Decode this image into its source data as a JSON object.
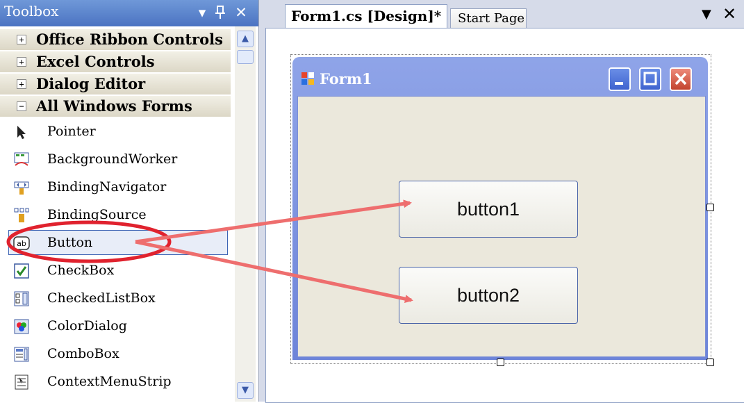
{
  "toolbox": {
    "title": "Toolbox",
    "dropdown_glyph": "▾",
    "pin_glyph": "ᵖ",
    "close_glyph": "✕",
    "categories": [
      {
        "label": "Office Ribbon Controls",
        "expand": "+"
      },
      {
        "label": "Excel Controls",
        "expand": "+"
      },
      {
        "label": "Dialog Editor",
        "expand": "+"
      },
      {
        "label": "All Windows Forms",
        "expand": "−"
      }
    ],
    "items": [
      {
        "label": "Pointer",
        "icon": "pointer-icon"
      },
      {
        "label": "BackgroundWorker",
        "icon": "background-worker-icon"
      },
      {
        "label": "BindingNavigator",
        "icon": "binding-navigator-icon"
      },
      {
        "label": "BindingSource",
        "icon": "binding-source-icon"
      },
      {
        "label": "Button",
        "icon": "button-icon"
      },
      {
        "label": "CheckBox",
        "icon": "checkbox-icon"
      },
      {
        "label": "CheckedListBox",
        "icon": "checked-listbox-icon"
      },
      {
        "label": "ColorDialog",
        "icon": "color-dialog-icon"
      },
      {
        "label": "ComboBox",
        "icon": "combobox-icon"
      },
      {
        "label": "ContextMenuStrip",
        "icon": "context-menu-strip-icon"
      }
    ],
    "selected_item": "Button",
    "scroll_up": "▲",
    "scroll_down": "▼"
  },
  "document_tabs": {
    "active": "Form1.cs [Design]*",
    "other": "Start Page",
    "dropdown_glyph": "▼",
    "close_glyph": "✕"
  },
  "form": {
    "title": "Form1",
    "buttons": [
      "button1",
      "button2"
    ]
  },
  "colors": {
    "toolbox_title_bg": "#5a82cc",
    "highlight_ellipse": "#e0222e",
    "arrow": "#ee6e6e",
    "form_frame": "#7b8ed9",
    "form_client": "#ebe8dc"
  }
}
